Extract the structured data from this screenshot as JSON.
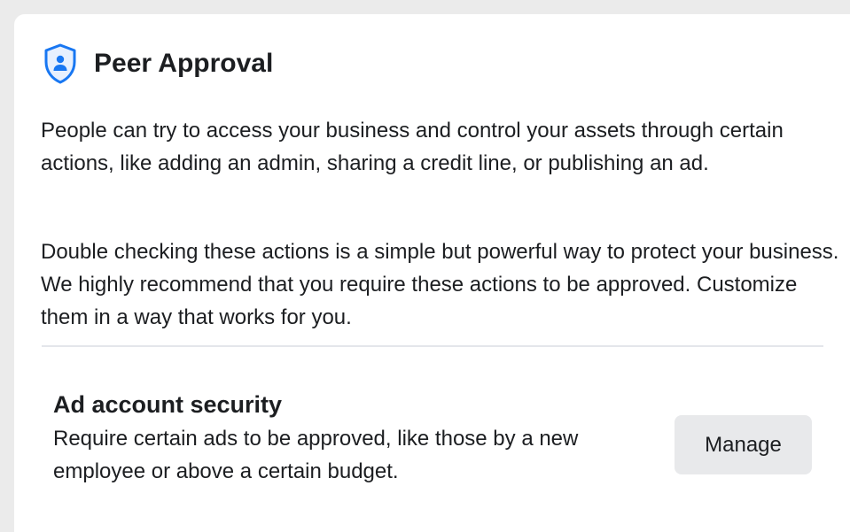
{
  "header": {
    "icon": "shield-person-icon",
    "title": "Peer Approval"
  },
  "intro": {
    "paragraph_1": "People can try to access your business and control your assets through certain actions, like adding an admin, sharing a credit line, or publishing an ad.",
    "paragraph_2": "Double checking these actions is a simple but powerful way to protect your business. We highly recommend that you require these actions to be approved. Customize them in a way that works for you."
  },
  "ad_account_security": {
    "title": "Ad account security",
    "description": "Require certain ads to be approved, like those by a new employee or above a certain budget.",
    "button_label": "Manage"
  },
  "colors": {
    "accent": "#1877f2",
    "background": "#ebebeb",
    "card": "#ffffff",
    "button_bg": "#e8e9eb",
    "text": "#1c1e21"
  }
}
